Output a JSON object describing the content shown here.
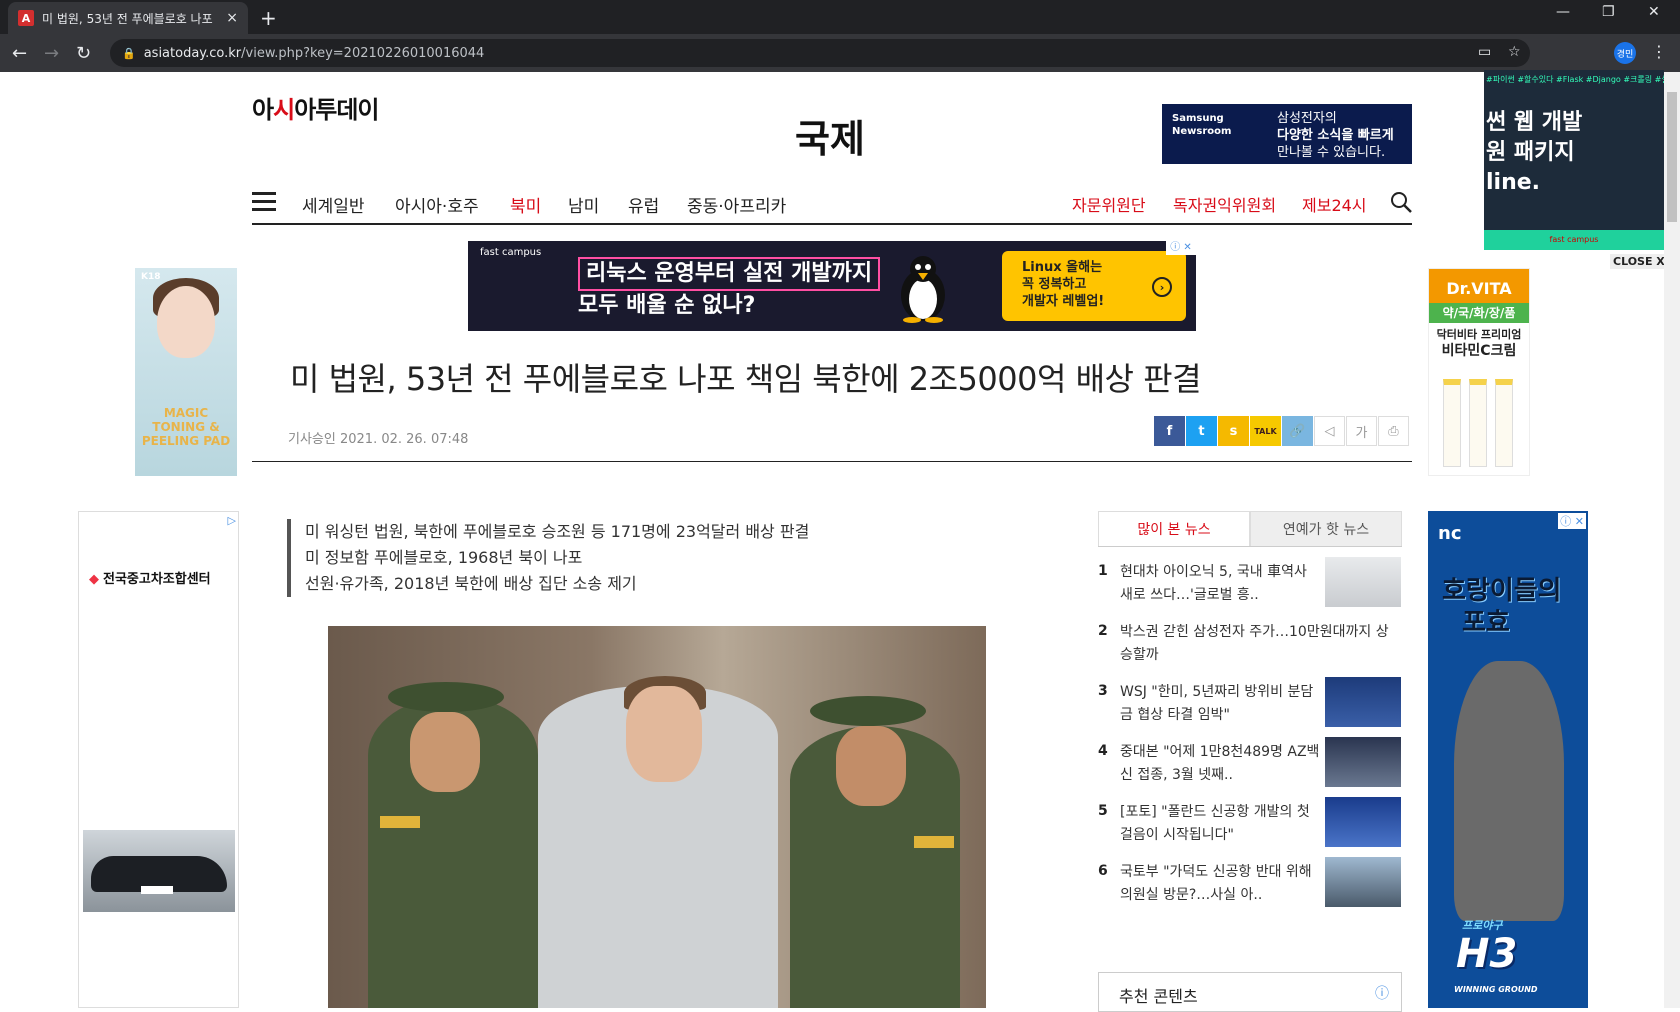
{
  "browser": {
    "tab_title": "미 법원, 53년 전 푸에블로호 나포",
    "tab_close": "×",
    "new_tab": "+",
    "url_domain": "asiatoday.co.kr",
    "url_path": "/view.php?key=20210226010016044",
    "profile": "경민",
    "win_minimize": "—",
    "win_restore": "❐",
    "win_close": "✕",
    "back": "←",
    "forward": "→",
    "reload": "↻",
    "lock": "🔒",
    "star": "☆",
    "menu": "⋮"
  },
  "site": {
    "logo_part1": "아",
    "logo_red": "시",
    "logo_part2": "아투데이",
    "section": "국제"
  },
  "samsung_ad": {
    "brand": "Samsung Newsroom",
    "line1": "삼성전자의",
    "line2": "다양한 소식을 빠르게",
    "line3": "만나볼 수 있습니다."
  },
  "nav": {
    "items": [
      "세계일반",
      "아시아·호주",
      "북미",
      "남미",
      "유럽",
      "중동·아프리카"
    ],
    "active": "북미",
    "right_items": [
      "자문위원단",
      "독자권익위원회",
      "제보24시"
    ]
  },
  "fast_ad": {
    "brand": "fast campus",
    "headline1": "리눅스 운영부터 실전 개발까지",
    "headline2": "모두 배울 순 없나?",
    "cta_line1": "Linux 올해는",
    "cta_line2": "꼭 정복하고",
    "cta_line3": "개발자 레벨업!",
    "arrow": "›",
    "adchoice": "ⓘ ✕"
  },
  "left_ad": {
    "brand": "K18",
    "copy1": "MAGIC TONING &",
    "copy2": "PEELING PAD"
  },
  "right_ad": {
    "brand": "Dr.VITA",
    "category": "약/국/화/장/품",
    "product1": "닥터비타 프리미엄",
    "product2": "비타민C크림"
  },
  "fixed_ad": {
    "keywords": "#파이썬 #할수있다 #Flask #Django #크롤링 #실전",
    "line1": "썬 웹 개발",
    "line2": "원 패키지",
    "line3": "line.",
    "footer": "fast campus",
    "close": "CLOSE X"
  },
  "article": {
    "title": "미 법원, 53년 전 푸에블로호 나포 책임 북한에 2조5000억 배상 판결",
    "date_label": "기사승인",
    "date": "2021. 02. 26. 07:48",
    "summary": [
      "미 워싱턴 법원, 북한에 푸에블로호 승조원 등 171명에 23억달러 배상 판결",
      "미 정보함 푸에블로호, 1968년 북이 나포",
      "선원·유가족, 2018년 북한에 배상 집단 소송 제기"
    ]
  },
  "share": {
    "facebook": "f",
    "twitter": "t",
    "kakaostory": "s",
    "kakaotalk": "TALK",
    "link": "🔗",
    "speaker": "◁",
    "font": "가",
    "print": "⎙"
  },
  "left_ad2": {
    "name": "전국중고차조합센터",
    "adchoice": "▷"
  },
  "news_box": {
    "tabs": [
      "많이 본 뉴스",
      "연예가 핫 뉴스"
    ],
    "items": [
      {
        "num": "1",
        "headline": "현대차 아이오닉 5, 국내 車역사 새로 쓰다…'글로벌 흥.."
      },
      {
        "num": "2",
        "headline": "박스권 갇힌 삼성전자 주가…10만원대까지 상승할까"
      },
      {
        "num": "3",
        "headline": "WSJ \"한미, 5년짜리 방위비 분담금 협상 타결 임박\""
      },
      {
        "num": "4",
        "headline": "중대본 \"어제 1만8천489명 AZ백신 접종, 3월 넷째.."
      },
      {
        "num": "5",
        "headline": "[포토] \"폴란드 신공항 개발의 첫 걸음이 시작됩니다\""
      },
      {
        "num": "6",
        "headline": "국토부 \"가덕도 신공항 반대 위해 의원실 방문?…사실 아.."
      }
    ],
    "recommend": "추천 콘텐츠"
  },
  "nc_ad": {
    "brand": "nc",
    "slogan1": "호랑이들의",
    "slogan2": "포효",
    "product": "H3",
    "product_sub": "프로야구",
    "tagline": "WINNING GROUND"
  }
}
